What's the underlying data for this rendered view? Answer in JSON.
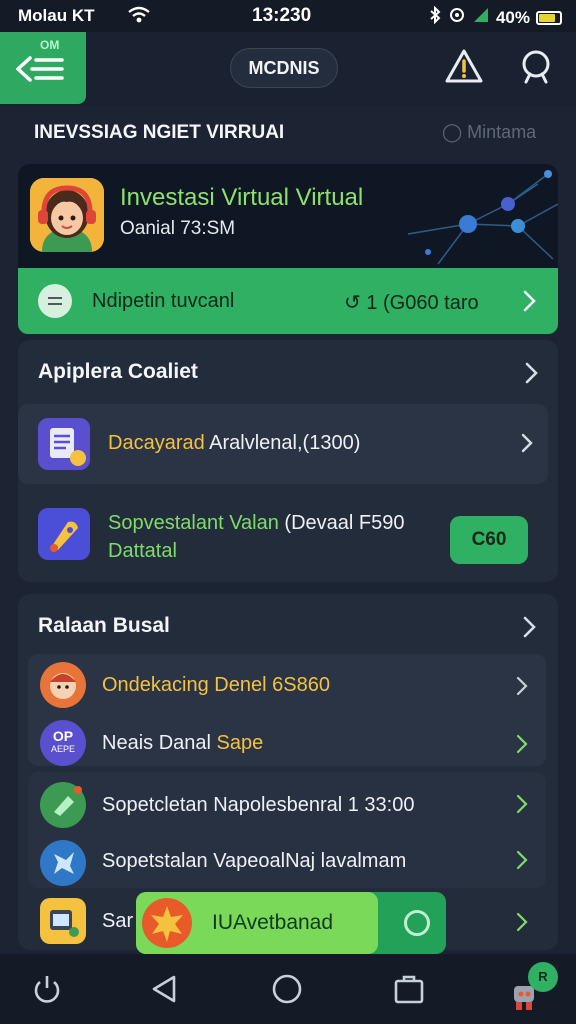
{
  "status_bar": {
    "carrier": "Molau KT",
    "time": "13:230",
    "battery": "40%"
  },
  "header": {
    "menu_badge": "OM",
    "title": "MCDNIS",
    "icons": [
      "menu-icon",
      "warning-icon",
      "search-icon"
    ]
  },
  "section": {
    "heading": "INEVSSIAG NGIET VIRRUAI",
    "right_label": "Mintama"
  },
  "hero": {
    "title": "Investasi Virtual Virtual",
    "subtitle": "Oanial 73:SM"
  },
  "green_bar": {
    "label": "Ndipetin tuvcanl",
    "right_label": "1  (G060 taro"
  },
  "card1": {
    "title": "Apiplera Coaliet",
    "rows": [
      {
        "text_accent": "Dacayarad",
        "text_rest": " Aralvlenal,(1300)"
      },
      {
        "text_accent": "Sopvestalant Valan",
        "text_rest": " (Devaal F590",
        "line2": "Dattatal",
        "button": "C60"
      }
    ]
  },
  "card2": {
    "title": "Ralaan Busal",
    "rows": [
      {
        "text": "Ondekacing Denel 6S860",
        "icon_text": ""
      },
      {
        "text_main": "Neais Danal ",
        "text_accent": "Sape",
        "icon_text": "OP",
        "icon_sub": "AEPE"
      },
      {
        "text": "Sopetcletan Napolesbenral 1 33:00"
      },
      {
        "text": "Sopetstalan VapeoalNaj lavalmam"
      },
      {
        "text": "Sar"
      }
    ]
  },
  "toast": {
    "label": "IUAvetbanad"
  },
  "navbar": {
    "badge": "R"
  },
  "colors": {
    "accent_green": "#2fb062",
    "light_green": "#7bd95a",
    "accent_yellow": "#f4c23e",
    "background": "#1c2433"
  }
}
